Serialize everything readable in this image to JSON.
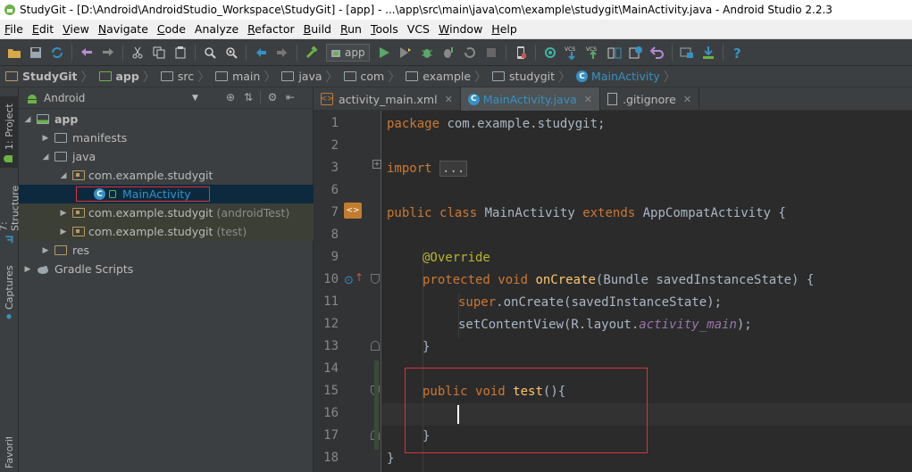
{
  "window": {
    "title": "StudyGit - [D:\\Android\\AndroidStudio_Workspace\\StudyGit] - [app] - ...\\app\\src\\main\\java\\com\\example\\studygit\\MainActivity.java - Android Studio 2.2.3"
  },
  "menu": [
    {
      "u": "F",
      "rest": "ile"
    },
    {
      "u": "E",
      "rest": "dit"
    },
    {
      "u": "V",
      "rest": "iew"
    },
    {
      "u": "N",
      "rest": "avigate"
    },
    {
      "u": "C",
      "rest": "ode"
    },
    {
      "u": "",
      "rest": "Analyze"
    },
    {
      "u": "R",
      "rest": "efactor"
    },
    {
      "u": "B",
      "rest": "uild"
    },
    {
      "u": "R",
      "rest": "un"
    },
    {
      "u": "T",
      "rest": "ools"
    },
    {
      "u": "",
      "rest": "VCS"
    },
    {
      "u": "W",
      "rest": "indow"
    },
    {
      "u": "H",
      "rest": "elp"
    }
  ],
  "toolbar": {
    "run_config": "app",
    "vcs_label": "VCS"
  },
  "breadcrumbs": [
    "StudyGit",
    "app",
    "src",
    "main",
    "java",
    "com",
    "example",
    "studygit",
    "MainActivity"
  ],
  "project_panel": {
    "view_mode": "Android",
    "tree": [
      {
        "label": "app",
        "suffix": ""
      },
      {
        "label": "manifests",
        "suffix": ""
      },
      {
        "label": "java",
        "suffix": ""
      },
      {
        "label": "com.example.studygit",
        "suffix": ""
      },
      {
        "label": "MainActivity",
        "suffix": ""
      },
      {
        "label": "com.example.studygit",
        "suffix": "(androidTest)"
      },
      {
        "label": "com.example.studygit",
        "suffix": "(test)"
      },
      {
        "label": "res",
        "suffix": ""
      },
      {
        "label": "Gradle Scripts",
        "suffix": ""
      }
    ]
  },
  "side_tabs": {
    "project": "1: Project",
    "structure": "7: Structure",
    "captures": "Captures",
    "favorites": "Favorites"
  },
  "editor_tabs": [
    {
      "label": "activity_main.xml"
    },
    {
      "label": "MainActivity.java"
    },
    {
      "label": ".gitignore"
    }
  ],
  "line_numbers": [
    "1",
    "2",
    "3",
    "6",
    "7",
    "8",
    "9",
    "10",
    "11",
    "12",
    "13",
    "14",
    "15",
    "16",
    "17",
    "18"
  ],
  "code": {
    "l1_kw": "package",
    "l1_rest": " com.example.studygit;",
    "l3_kw": "import",
    "l3_fold": "...",
    "l7_kw1": "public",
    "l7_kw2": "class",
    "l7_name": " MainActivity ",
    "l7_kw3": "extends",
    "l7_rest": " AppCompatActivity {",
    "l9_ann": "@Override",
    "l10_kw1": "protected",
    "l10_kw2": "void",
    "l10_fn": "onCreate",
    "l10_rest": "(Bundle savedInstanceState) {",
    "l11_kw": "super",
    "l11_rest": ".onCreate(savedInstanceState);",
    "l12_pre": "setContentView(R.layout.",
    "l12_it": "activity_main",
    "l12_post": ");",
    "l13": "}",
    "l15_kw1": "public",
    "l15_kw2": "void",
    "l15_fn": "test",
    "l15_rest": "(){",
    "l17": "}",
    "l18": "}"
  }
}
